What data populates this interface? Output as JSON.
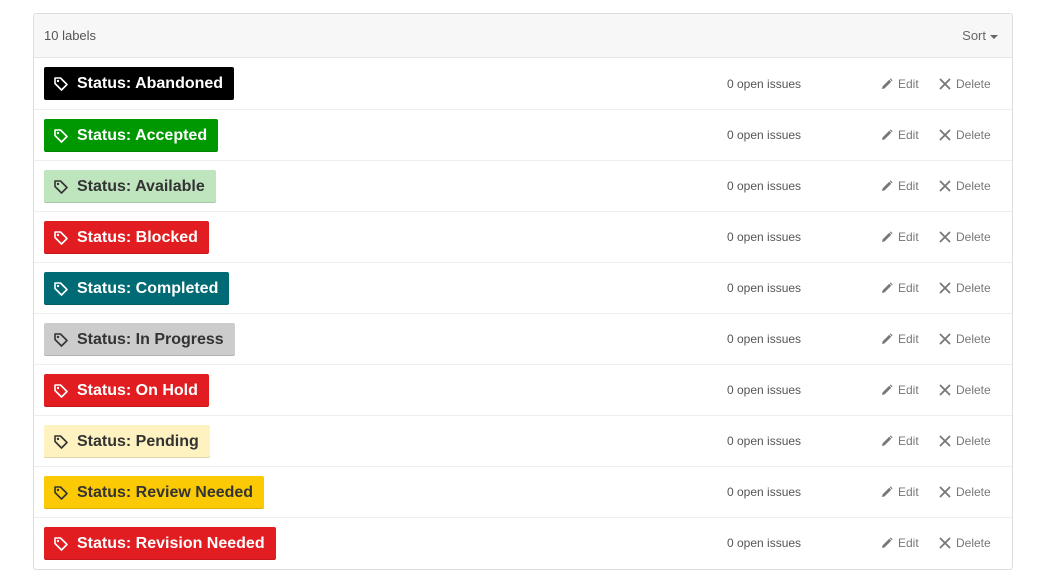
{
  "header": {
    "count_text": "10 labels",
    "sort_label": "Sort"
  },
  "actions": {
    "edit_label": "Edit",
    "delete_label": "Delete"
  },
  "icons": {
    "tag": "tag-icon",
    "edit": "pencil-icon",
    "delete": "x-icon",
    "sort_caret": "caret-down-icon"
  },
  "labels": [
    {
      "name": "Status: Abandoned",
      "color": "#000000",
      "text_color": "#ffffff",
      "issues": "0 open issues"
    },
    {
      "name": "Status: Accepted",
      "color": "#009800",
      "text_color": "#ffffff",
      "issues": "0 open issues"
    },
    {
      "name": "Status: Available",
      "color": "#bfe5bf",
      "text_color": "#333333",
      "issues": "0 open issues"
    },
    {
      "name": "Status: Blocked",
      "color": "#e11d21",
      "text_color": "#ffffff",
      "issues": "0 open issues"
    },
    {
      "name": "Status: Completed",
      "color": "#006b75",
      "text_color": "#ffffff",
      "issues": "0 open issues"
    },
    {
      "name": "Status: In Progress",
      "color": "#cccccc",
      "text_color": "#333333",
      "issues": "0 open issues"
    },
    {
      "name": "Status: On Hold",
      "color": "#e11d21",
      "text_color": "#ffffff",
      "issues": "0 open issues"
    },
    {
      "name": "Status: Pending",
      "color": "#fef2c0",
      "text_color": "#333333",
      "issues": "0 open issues"
    },
    {
      "name": "Status: Review Needed",
      "color": "#fbca04",
      "text_color": "#333333",
      "issues": "0 open issues"
    },
    {
      "name": "Status: Revision Needed",
      "color": "#e11d21",
      "text_color": "#ffffff",
      "issues": "0 open issues"
    }
  ]
}
